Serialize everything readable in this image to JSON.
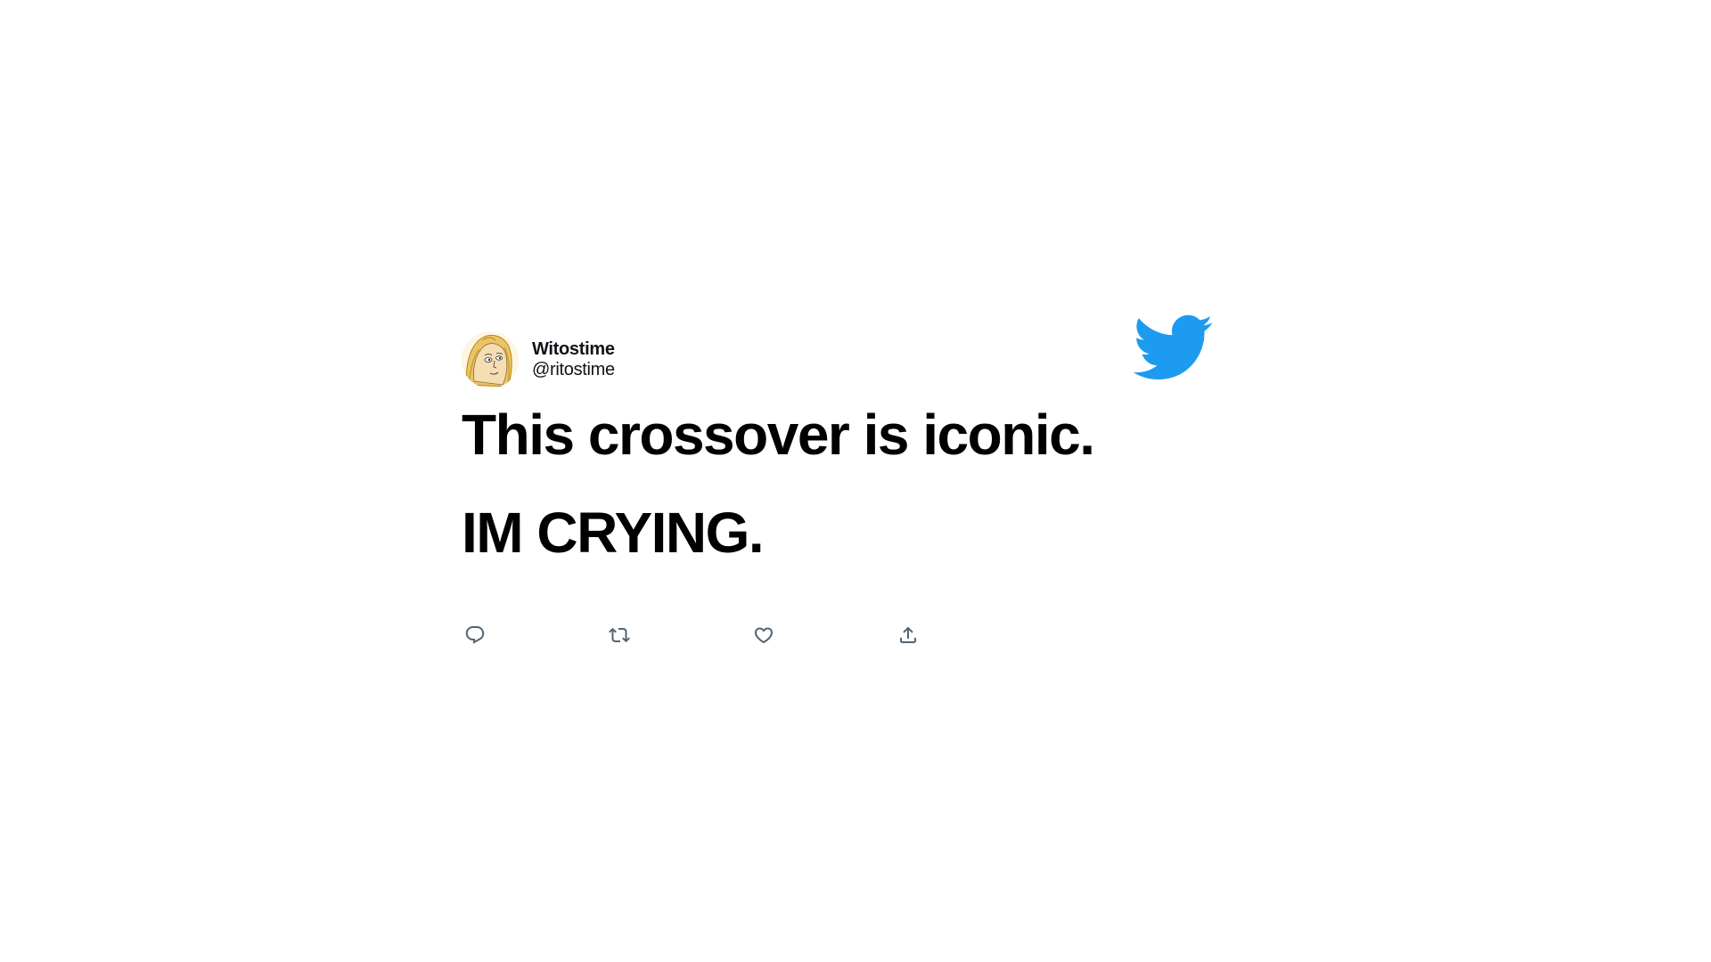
{
  "tweet": {
    "author": {
      "display_name": "Witostime",
      "handle": "@ritostime",
      "avatar_icon": "illustrated-portrait-avatar"
    },
    "logo_icon": "twitter-bird-icon",
    "lines": [
      "This crossover is iconic.",
      "IM CRYING."
    ],
    "actions": [
      {
        "name": "reply",
        "icon": "reply-icon"
      },
      {
        "name": "retweet",
        "icon": "retweet-icon"
      },
      {
        "name": "like",
        "icon": "heart-icon"
      },
      {
        "name": "share",
        "icon": "share-icon"
      }
    ]
  },
  "colors": {
    "twitter_blue": "#1d9bf0",
    "text": "#000000",
    "icon_gray": "#536471",
    "background": "#ffffff"
  }
}
